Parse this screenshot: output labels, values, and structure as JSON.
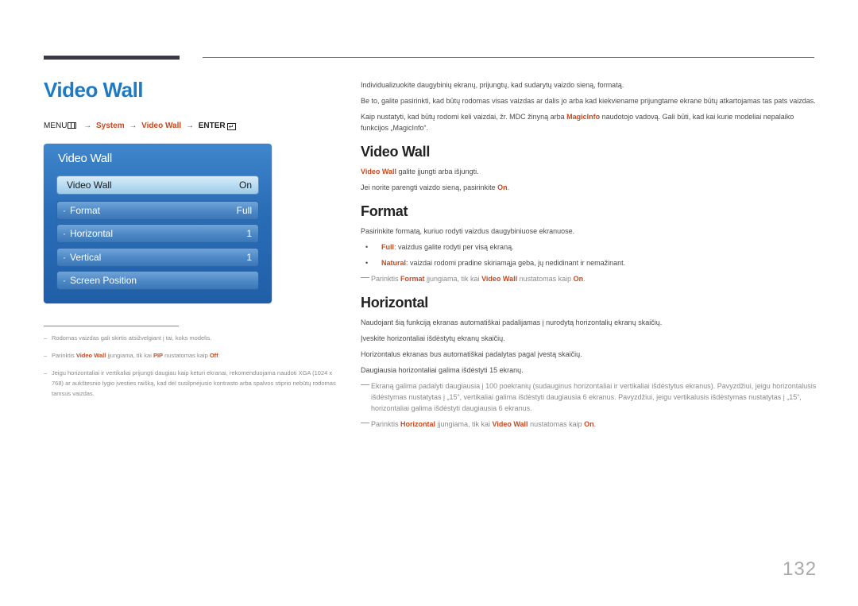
{
  "page": {
    "title": "Video Wall",
    "number": "132"
  },
  "menu_path": {
    "menu": "MENU",
    "system": "System",
    "video_wall": "Video Wall",
    "enter": "ENTER",
    "arrow": "→"
  },
  "osd": {
    "title": "Video Wall",
    "items": [
      {
        "label": "Video Wall",
        "value": "On",
        "bullet": ""
      },
      {
        "label": "Format",
        "value": "Full",
        "bullet": "·"
      },
      {
        "label": "Horizontal",
        "value": "1",
        "bullet": "·"
      },
      {
        "label": "Vertical",
        "value": "1",
        "bullet": "·"
      },
      {
        "label": "Screen Position",
        "value": "",
        "bullet": "·"
      }
    ]
  },
  "footnotes": {
    "dash": "–",
    "fn1": "Rodomas vaizdas gali skirtis atsižvelgiant į tai, koks modelis.",
    "fn2": {
      "pre": "Parinktis ",
      "hl1": "Video Wall",
      "mid": " įjungiama, tik kai ",
      "hl2": "PIP",
      "mid2": " nustatomas kaip ",
      "hl3": "Off",
      "post": "."
    },
    "fn3": "Jeigu horizontaliai ir vertikaliai prijungti daugiau kaip keturi ekranai, rekomenduojama naudoti XGA (1024 x 768) ar aukštesnio lygio įvesties raišką, kad dėl susilpnėjusio kontrasto arba spalvos stiprio nebūtų rodomas tamsus vaizdas."
  },
  "intro": {
    "p1": "Individualizuokite daugybinių ekranų, prijungtų, kad sudarytų vaizdo sieną, formatą.",
    "p2": "Be to, galite pasirinkti, kad būtų rodomas visas vaizdas ar dalis jo arba kad kiekviename prijungtame ekrane būtų atkartojamas tas pats vaizdas.",
    "p3_pre": "Kaip nustatyti, kad būtų rodomi keli vaizdai, žr. MDC žinyną arba ",
    "p3_hl": "MagicInfo",
    "p3_post": " naudotojo vadovą. Gali būti, kad kai kurie modeliai nepalaiko funkcijos „MagicInfo“."
  },
  "section_video_wall": {
    "heading": "Video Wall",
    "p1_hl": "Video Wall",
    "p1_post": " galite įjungti arba išjungti.",
    "p2_pre": "Jei norite parengti vaizdo sieną, pasirinkite ",
    "p2_hl": "On",
    "p2_post": "."
  },
  "section_format": {
    "heading": "Format",
    "intro": "Pasirinkite formatą, kuriuo rodyti vaizdus daugybiniuose ekranuose.",
    "bullet_char": "•",
    "bullets": [
      {
        "hl": "Full",
        "text": ": vaizdus galite rodyti per visą ekraną."
      },
      {
        "hl": "Natural",
        "text": ": vaizdai rodomi pradine skiriamąja geba, jų nedidinant ir nemažinant."
      }
    ],
    "note": {
      "pre": "Parinktis ",
      "hl1": "Format",
      "mid": " įjungiama, tik kai ",
      "hl2": "Video Wall",
      "mid2": " nustatomas kaip ",
      "hl3": "On",
      "post": "."
    }
  },
  "section_horizontal": {
    "heading": "Horizontal",
    "p1": "Naudojant šią funkciją ekranas automatiškai padalijamas į nurodytą horizontalių ekranų skaičių.",
    "p2": "Įveskite horizontaliai išdėstytų ekranų skaičių.",
    "p3": "Horizontalus ekranas bus automatiškai padalytas pagal įvestą skaičių.",
    "p4": "Daugiausia horizontaliai galima išdėstyti 15 ekranų.",
    "note1": "Ekraną galima padalyti daugiausia į 100 poekranių (sudauginus horizontaliai ir vertikaliai išdėstytus ekranus). Pavyzdžiui, jeigu horizontalusis išdėstymas nustatytas į „15“, vertikaliai galima išdėstyti daugiausia 6 ekranus. Pavyzdžiui, jeigu vertikalusis išdėstymas nustatytas į „15“, horizontaliai galima išdėstyti daugiausia 6 ekranus.",
    "note2": {
      "pre": "Parinktis ",
      "hl1": "Horizontal",
      "mid": " įjungiama, tik kai ",
      "hl2": "Video Wall",
      "mid2": " nustatomas kaip ",
      "hl3": "On",
      "post": "."
    }
  }
}
